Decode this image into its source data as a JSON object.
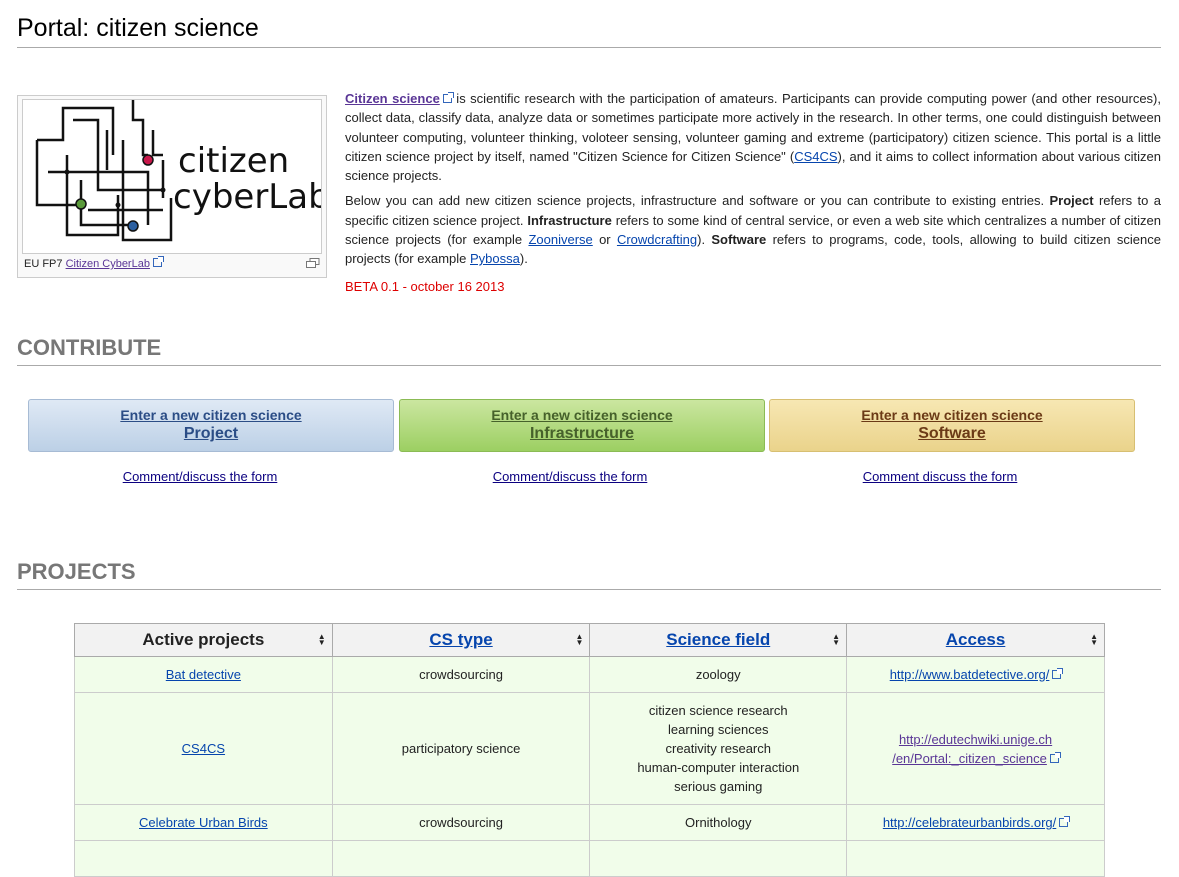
{
  "page": {
    "title": "Portal: citizen science"
  },
  "thumb": {
    "logo_word1": "citizen",
    "logo_word2": "cyberLab",
    "caption_prefix": "EU FP7",
    "caption_link": "Citizen CyberLab"
  },
  "intro": {
    "p1_link": "Citizen science",
    "p1_text": " is scientific research with the participation of amateurs. Participants can provide computing power (and other resources), collect data, classify data, analyze data or sometimes participate more actively in the research. In other terms, one could distinguish between volunteer computing, volunteer thinking, voloteer sensing, volunteer gaming and extreme (participatory) citizen science. This portal is a little citizen science project by itself, named \"Citizen Science for Citizen Science\" (",
    "p1_cs4cs": "CS4CS",
    "p1_end": "), and it aims to collect information about various citizen science projects.",
    "p2_a": "Below you can add new citizen science projects, infrastructure and software or you can contribute to existing entries. ",
    "p2_project_b": "Project",
    "p2_b": " refers to a specific citizen science project. ",
    "p2_infra_b": "Infrastructure",
    "p2_c": " refers to some kind of central service, or even a web site which centralizes a number of citizen science projects (for example ",
    "p2_zooniverse": "Zooniverse",
    "p2_or": " or ",
    "p2_crowdcrafting": "Crowdcrafting",
    "p2_d": "). ",
    "p2_software_b": "Software",
    "p2_e": " refers to programs, code, tools, allowing to build citizen science projects (for example ",
    "p2_pybossa": "Pybossa",
    "p2_f": ").",
    "beta": "BETA 0.1 - october 16 2013"
  },
  "contribute": {
    "heading": "CONTRIBUTE",
    "buttons": [
      {
        "line1": "Enter a new citizen science",
        "line2": "Project"
      },
      {
        "line1": "Enter a new citizen science",
        "line2": "Infrastructure"
      },
      {
        "line1": "Enter a new citizen science",
        "line2": "Software"
      }
    ],
    "comments": [
      "Comment/discuss the form",
      "Comment/discuss the form",
      "Comment discuss the form"
    ]
  },
  "projects": {
    "heading": "PROJECTS",
    "columns": [
      "Active projects",
      "CS type",
      "Science field",
      "Access"
    ],
    "rows": [
      {
        "name": "Bat detective",
        "cs_type": "crowdsourcing",
        "fields": [
          "zoology"
        ],
        "access": [
          "http://www.batdetective.org/"
        ]
      },
      {
        "name": "CS4CS",
        "cs_type": "participatory science",
        "fields": [
          "citizen science research",
          "learning sciences",
          "creativity research",
          "human-computer interaction",
          "serious gaming"
        ],
        "access": [
          "http://edutechwiki.unige.ch",
          "/en/Portal:_citizen_science"
        ]
      },
      {
        "name": "Celebrate Urban Birds",
        "cs_type": "crowdsourcing",
        "fields": [
          "Ornithology"
        ],
        "access": [
          "http://celebrateurbanbirds.org/"
        ]
      }
    ]
  }
}
